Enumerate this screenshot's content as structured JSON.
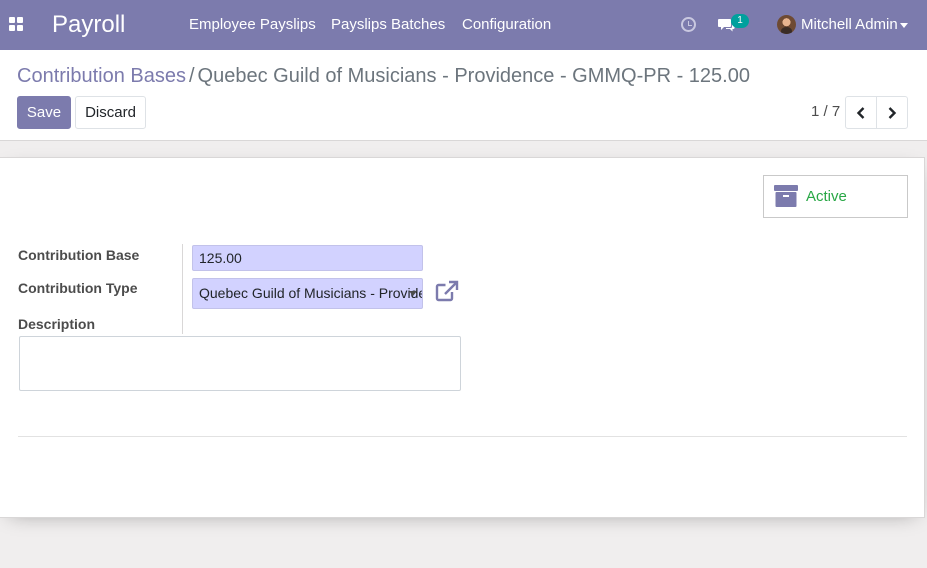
{
  "navbar": {
    "app_title": "Payroll",
    "menu": [
      "Employee Payslips",
      "Payslips Batches",
      "Configuration"
    ],
    "chat_badge": "1",
    "user_name": "Mitchell Admin"
  },
  "breadcrumb": {
    "parent": "Contribution Bases",
    "separator": "/",
    "current": "Quebec Guild of Musicians - Providence - GMMQ-PR - 125.00"
  },
  "toolbar": {
    "save_label": "Save",
    "discard_label": "Discard"
  },
  "pager": {
    "value": "1 / 7"
  },
  "form": {
    "status_button_label": "Active",
    "contribution_base_label": "Contribution Base",
    "contribution_base_value": "125.00",
    "contribution_type_label": "Contribution Type",
    "contribution_type_value": "Quebec Guild of Musicians - Providence",
    "description_label": "Description",
    "description_value": ""
  },
  "colors": {
    "brand": "#7c7bad",
    "badge": "#00a09d",
    "active_text": "#28a745",
    "field_bg": "#d2d2ff"
  },
  "icons": [
    "apps-icon",
    "clock-icon",
    "chat-icon",
    "user-avatar",
    "chevron-left-icon",
    "chevron-right-icon",
    "archive-icon",
    "external-link-icon",
    "caret-down-icon"
  ]
}
